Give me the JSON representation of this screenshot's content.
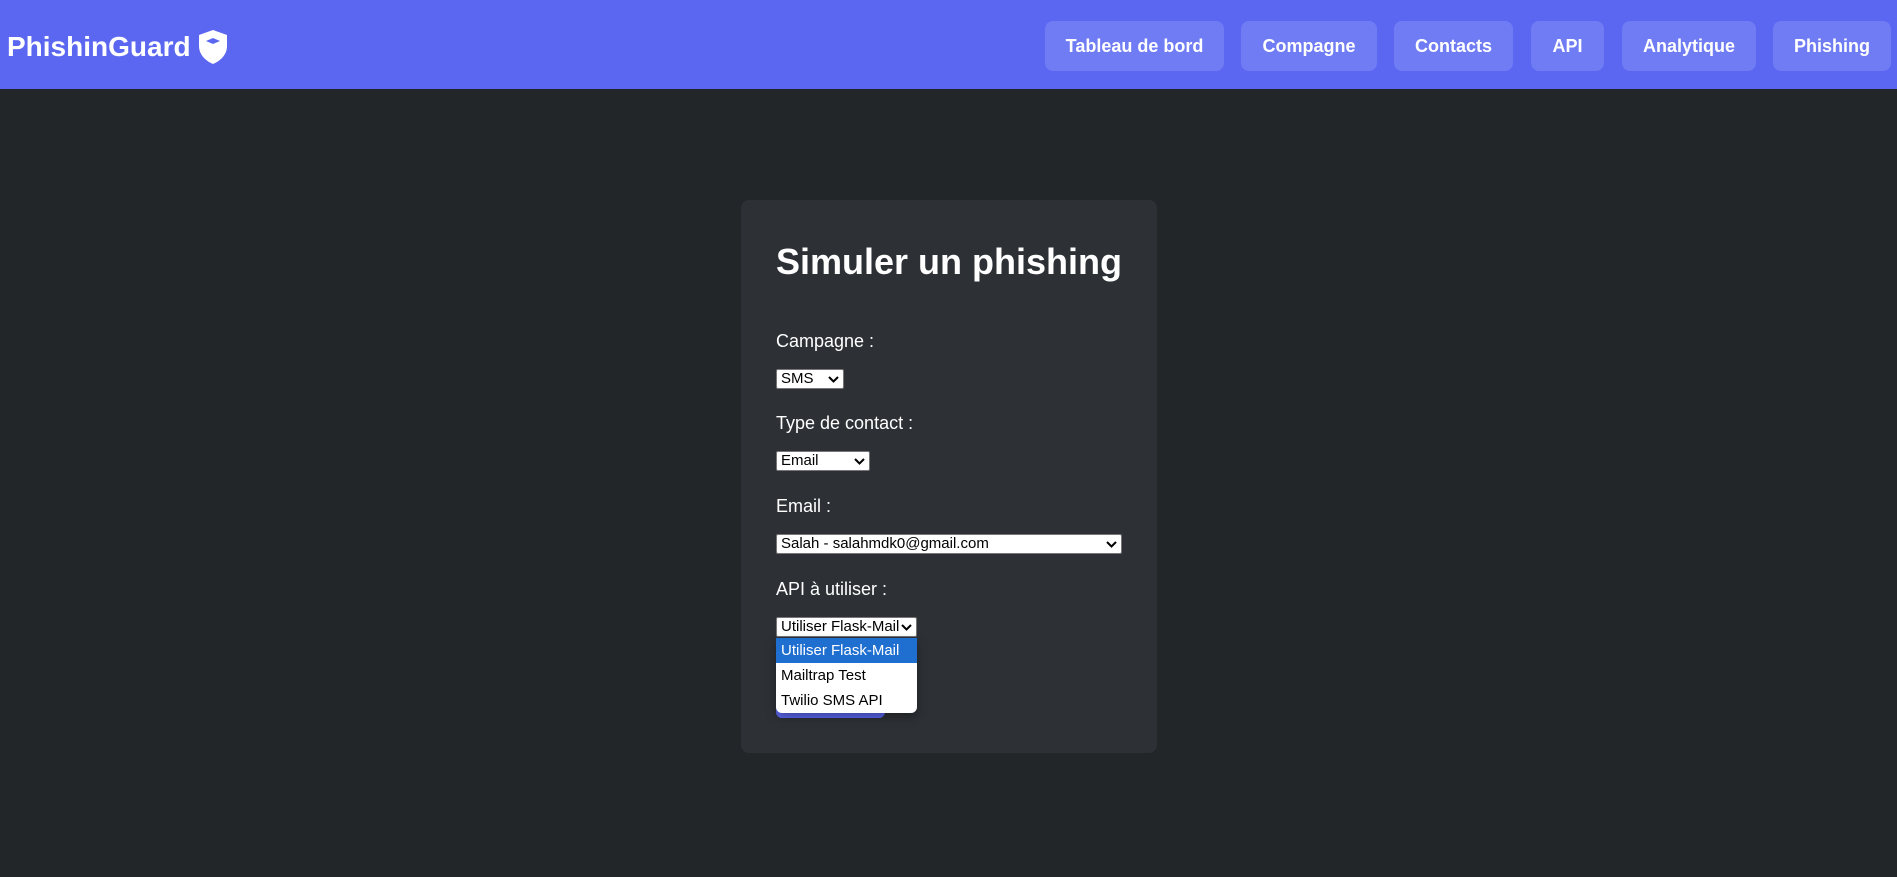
{
  "brand": {
    "name": "PhishinGuard",
    "icon": "shield-icon"
  },
  "nav": {
    "items": [
      {
        "label": "Tableau de bord"
      },
      {
        "label": "Compagne"
      },
      {
        "label": "Contacts"
      },
      {
        "label": "API"
      },
      {
        "label": "Analytique"
      },
      {
        "label": "Phishing"
      }
    ]
  },
  "form": {
    "title": "Simuler un phishing",
    "campaign": {
      "label": "Campagne :",
      "value": "SMS"
    },
    "contact_type": {
      "label": "Type de contact :",
      "value": "Email"
    },
    "email": {
      "label": "Email :",
      "value": "Salah - salahmdk0@gmail.com"
    },
    "api": {
      "label": "API à utiliser :",
      "value": "Utiliser Flask-Mail",
      "options": [
        "Utiliser Flask-Mail",
        "Mailtrap Test",
        "Twilio SMS API"
      ],
      "selected_index": 0
    }
  },
  "colors": {
    "nav_bg": "#5b67f1",
    "nav_button_bg": "#707cf4",
    "page_bg": "#222629",
    "card_bg": "#2d3135",
    "option_highlight": "#1f6fd1"
  }
}
